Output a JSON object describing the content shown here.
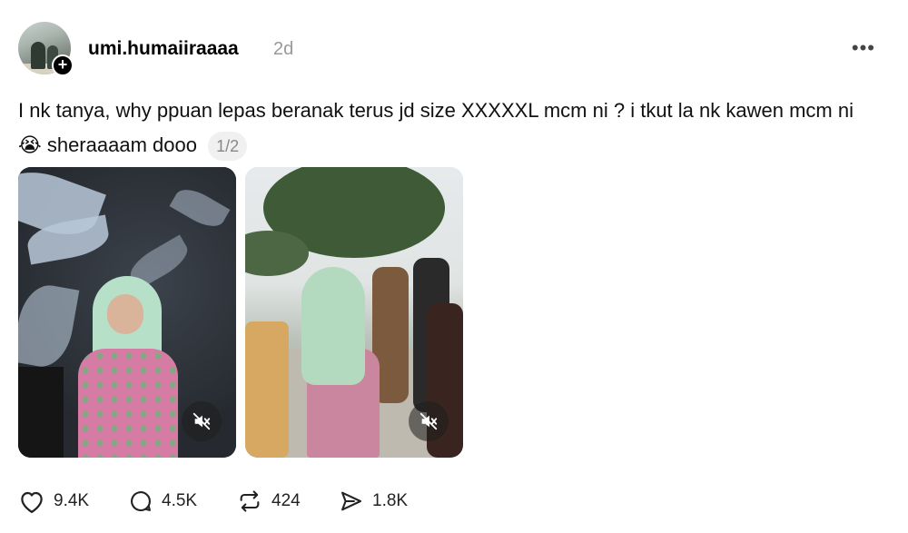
{
  "post": {
    "username": "umi.humaiiraaaa",
    "time": "2d",
    "more_label": "•••",
    "text_before_emoji": "I nk tanya, why ppuan lepas beranak terus jd size XXXXXL mcm ni ? i tkut la nk kawen mcm ni ",
    "emoji": "😭",
    "text_after_emoji": " sheraaaam dooo",
    "page_indicator": "1/2"
  },
  "media": [
    {
      "type": "video",
      "muted": true,
      "icon": "speaker-muted-icon"
    },
    {
      "type": "video",
      "muted": true,
      "icon": "speaker-muted-icon"
    }
  ],
  "actions": {
    "likes": "9.4K",
    "comments": "4.5K",
    "reposts": "424",
    "shares": "1.8K"
  },
  "colors": {
    "text": "#000000",
    "muted_text": "#999999",
    "badge_bg": "#f0f0f0"
  }
}
